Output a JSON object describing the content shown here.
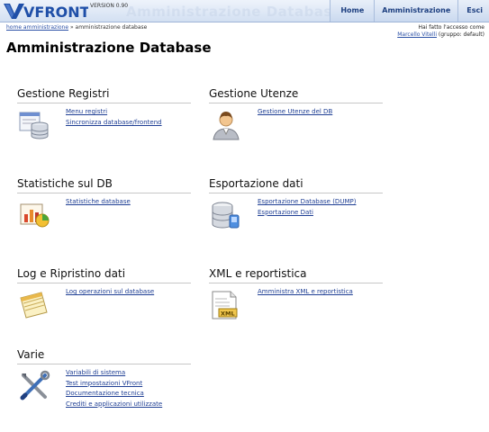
{
  "header": {
    "logo_text": "VFRONT",
    "version": "VERSION 0.90",
    "ghost_title": "Amministrazione Database",
    "nav": [
      "Home",
      "Amministrazione",
      "Esci"
    ]
  },
  "breadcrumb": {
    "home": "home amministrazione",
    "separator": " » ",
    "current": "amministrazione database"
  },
  "user": {
    "line1": "Hai fatto l'accesso come",
    "name": "Marcello Vitelli",
    "group": " (gruppo: default)"
  },
  "page_title": "Amministrazione Database",
  "sections": {
    "registri": {
      "title": "Gestione Registri",
      "icon": "registry-database-icon",
      "links": [
        "Menu registri",
        "Sincronizza database/frontend"
      ]
    },
    "utenze": {
      "title": "Gestione Utenze",
      "icon": "user-icon",
      "links": [
        "Gestione Utenze del DB"
      ]
    },
    "statistiche": {
      "title": "Statistiche sul DB",
      "icon": "statistics-chart-icon",
      "links": [
        "Statistiche database"
      ]
    },
    "esportazione": {
      "title": "Esportazione dati",
      "icon": "database-export-icon",
      "links": [
        "Esportazione Database (DUMP)",
        "Esportazione Dati"
      ]
    },
    "log": {
      "title": "Log e Ripristino dati",
      "icon": "log-notepad-icon",
      "links": [
        "Log operazioni sul database"
      ]
    },
    "xml": {
      "title": "XML e reportistica",
      "icon": "xml-document-icon",
      "links": [
        "Amministra XML e reportistica"
      ]
    },
    "varie": {
      "title": "Varie",
      "icon": "tools-icon",
      "links": [
        "Variabili di sistema",
        "Test impostazioni VFront",
        "Documentazione tecnica",
        "Crediti e applicazioni utilizzate"
      ]
    }
  },
  "colors": {
    "link": "#1f3f94",
    "nav_text": "#1d3f80",
    "header_bg": "#d3e0f2"
  }
}
